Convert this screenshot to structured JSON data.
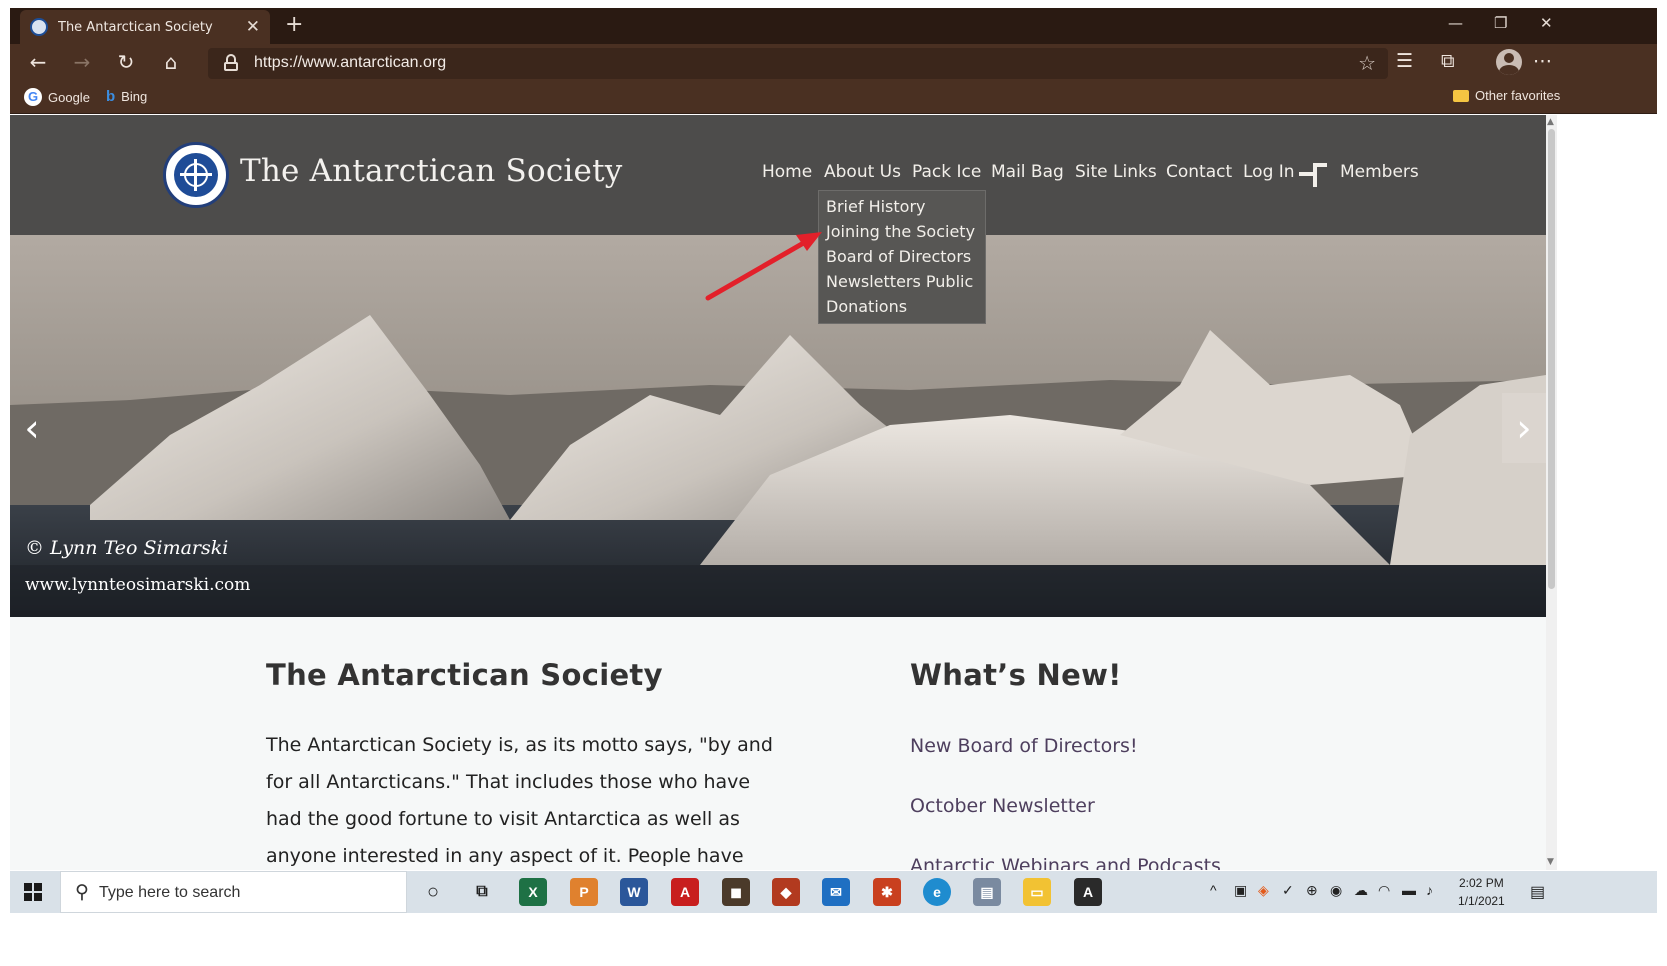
{
  "browser": {
    "tab_title": "The Antarctican Society",
    "tab_close": "✕",
    "new_tab": "+",
    "url": "https://www.antarctican.org",
    "favorites": [
      {
        "label": "Google",
        "icon": "google-icon"
      },
      {
        "label": "Bing",
        "icon": "bing-icon"
      }
    ],
    "other_favorites": "Other favorites"
  },
  "site": {
    "title": "The Antarctican Society",
    "nav": [
      "Home",
      "About Us",
      "Pack Ice",
      "Mail Bag",
      "Site Links",
      "Contact",
      "Log In",
      "Members"
    ],
    "dropdown": [
      "Brief History",
      "Joining the Society",
      "Board of Directors",
      "Newsletters Public",
      "Donations"
    ],
    "hero": {
      "signature": "© Lynn Teo Simarski",
      "credit": "www.lynnteosimarski.com"
    },
    "left_heading": "The Antarctican Society",
    "body_text": "The Antarctican Society is, as its motto says, \"by and for all Antarcticans.\" That includes those who have had the good fortune to visit Antarctica as well as anyone interested in any aspect of it. People have always been",
    "right_heading": "What’s New!",
    "news_items": [
      "New Board of Directors!",
      "October Newsletter",
      "Antarctic Webinars and Podcasts"
    ]
  },
  "taskbar": {
    "search_placeholder": "Type here to search",
    "time": "2:02 PM",
    "date": "1/1/2021"
  },
  "colors": {
    "browser_dark": "#2a1a12",
    "browser_toolbar": "#4a3022",
    "site_header": "#4d4c4b",
    "annotation_arrow": "#e3202a",
    "news_link": "#4e3f5e"
  }
}
